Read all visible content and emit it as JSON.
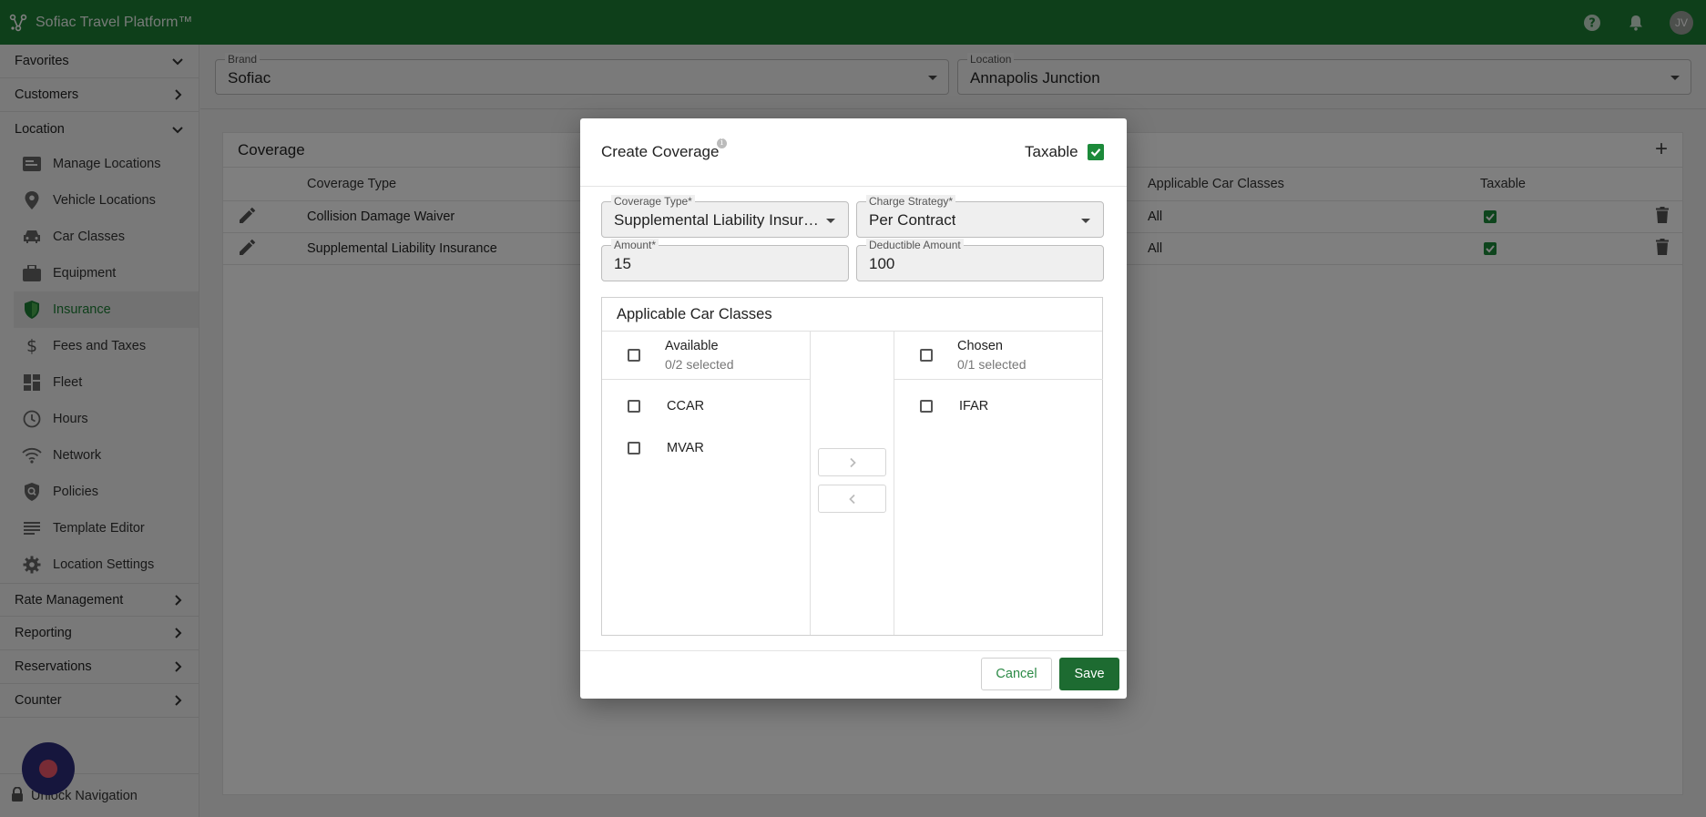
{
  "app": {
    "title": "Sofiac Travel Platform™",
    "avatar_initials": "JV",
    "brand_color": "#1c7e34"
  },
  "sidebar": {
    "groups_top": [
      {
        "label": "Favorites",
        "chevron": "down"
      },
      {
        "label": "Customers",
        "chevron": "right"
      },
      {
        "label": "Location",
        "chevron": "down"
      }
    ],
    "location_items": [
      {
        "label": "Manage Locations",
        "icon": "id-card-icon"
      },
      {
        "label": "Vehicle Locations",
        "icon": "map-pin-icon"
      },
      {
        "label": "Car Classes",
        "icon": "car-icon"
      },
      {
        "label": "Equipment",
        "icon": "briefcase-icon"
      },
      {
        "label": "Insurance",
        "icon": "shield-icon",
        "active": true
      },
      {
        "label": "Fees and Taxes",
        "icon": "dollar-icon"
      },
      {
        "label": "Fleet",
        "icon": "dashboard-icon"
      },
      {
        "label": "Hours",
        "icon": "clock-icon"
      },
      {
        "label": "Network",
        "icon": "wifi-icon"
      },
      {
        "label": "Policies",
        "icon": "policy-icon"
      },
      {
        "label": "Template Editor",
        "icon": "lines-icon"
      },
      {
        "label": "Location Settings",
        "icon": "gear-icon"
      }
    ],
    "groups_bottom": [
      {
        "label": "Rate Management",
        "chevron": "right"
      },
      {
        "label": "Reporting",
        "chevron": "right"
      },
      {
        "label": "Reservations",
        "chevron": "right"
      },
      {
        "label": "Counter",
        "chevron": "right"
      }
    ],
    "unlock_label": "Unlock Navigation"
  },
  "filters": {
    "brand": {
      "label": "Brand",
      "value": "Sofiac"
    },
    "location": {
      "label": "Location",
      "value": "Annapolis Junction"
    }
  },
  "coverage": {
    "title": "Coverage",
    "columns": {
      "coverage_type": "Coverage Type",
      "applicable_car_classes": "Applicable Car Classes",
      "taxable": "Taxable"
    },
    "rows": [
      {
        "coverage_type": "Collision Damage Waiver",
        "applicable_car_classes": "All",
        "taxable": true
      },
      {
        "coverage_type": "Supplemental Liability Insurance",
        "applicable_car_classes": "All",
        "taxable": true
      }
    ]
  },
  "dialog": {
    "title": "Create Coverage",
    "info_glyph": "i",
    "taxable_label": "Taxable",
    "taxable_checked": true,
    "coverage_type": {
      "label": "Coverage Type",
      "required_mark": "*",
      "value": "Supplemental Liability Insurance"
    },
    "charge_strategy": {
      "label": "Charge Strategy",
      "required_mark": "*",
      "value": "Per Contract"
    },
    "amount": {
      "label": "Amount",
      "required_mark": "*",
      "value": "15"
    },
    "deductible": {
      "label": "Deductible Amount",
      "value": "100"
    },
    "transfer": {
      "title": "Applicable Car Classes",
      "available": {
        "label": "Available",
        "selected_text": "0/2 selected",
        "items": [
          "CCAR",
          "MVAR"
        ]
      },
      "chosen": {
        "label": "Chosen",
        "selected_text": "0/1 selected",
        "items": [
          "IFAR"
        ]
      }
    },
    "cancel_label": "Cancel",
    "save_label": "Save"
  }
}
